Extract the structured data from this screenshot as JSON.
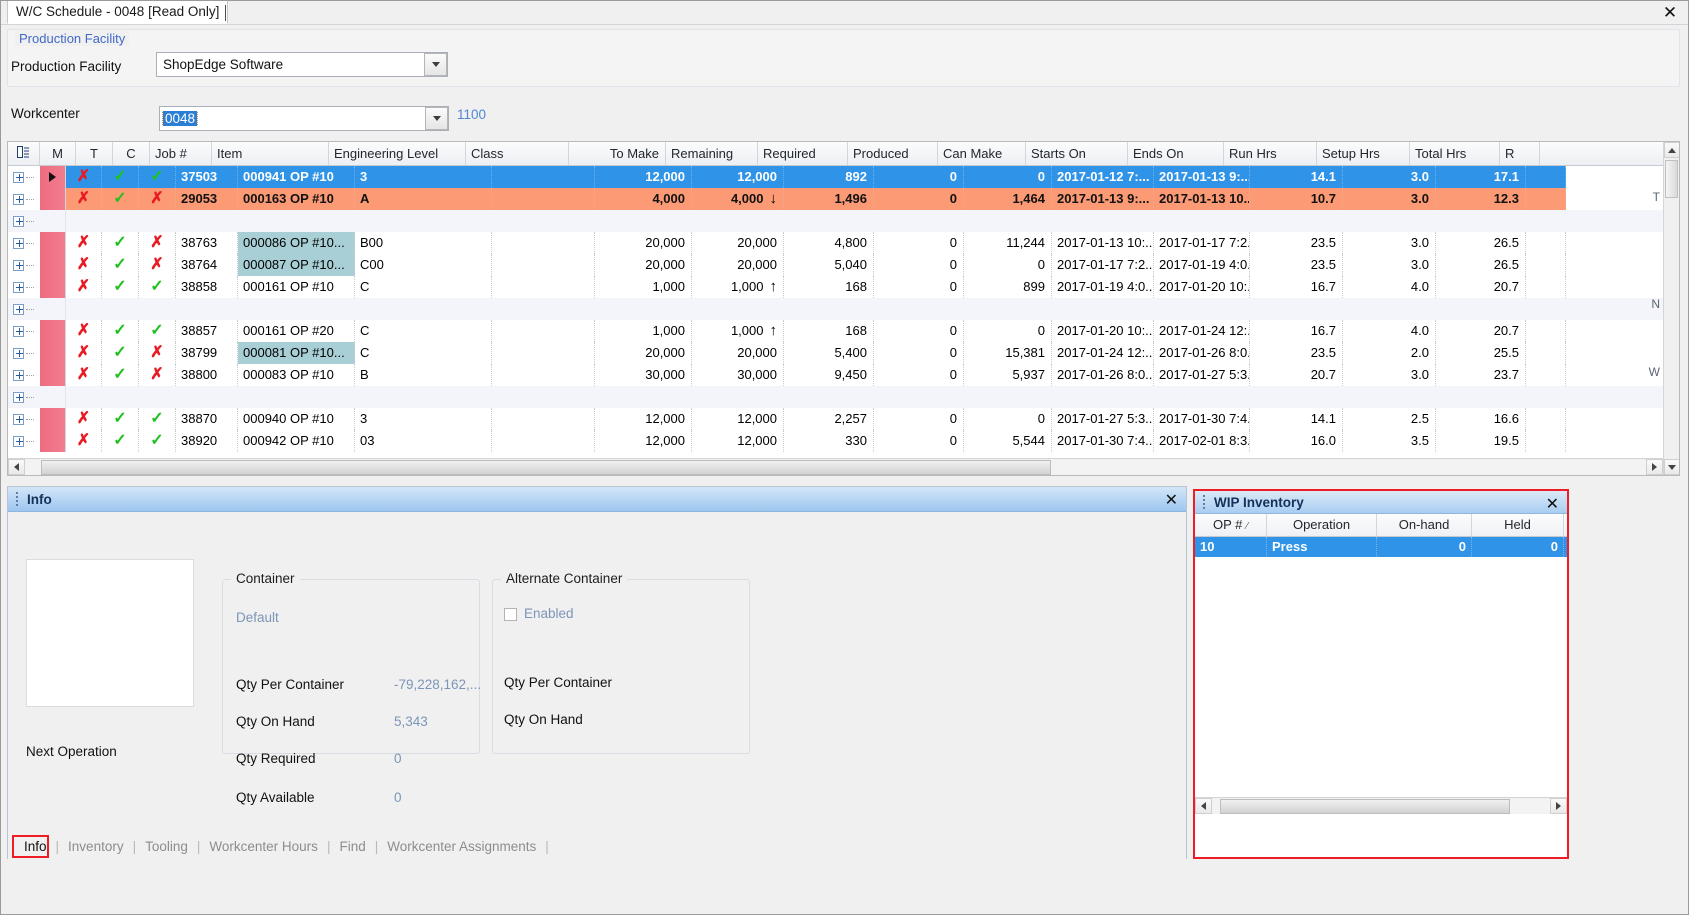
{
  "window": {
    "tab_title": "W/C Schedule - 0048 [Read Only]",
    "close_label": "✕"
  },
  "production_facility_group": {
    "legend": "Production Facility",
    "label": "Production Facility",
    "value": "ShopEdge Software"
  },
  "workcenter": {
    "label": "Workcenter",
    "value": "0048",
    "extra": "1100"
  },
  "grid": {
    "columns": [
      "M",
      "T",
      "C",
      "Job #",
      "Item",
      "Engineering Level",
      "Class",
      "To Make",
      "Remaining",
      "Required",
      "Produced",
      "Can Make",
      "Starts On",
      "Ends On",
      "Run Hrs",
      "Setup Hrs",
      "Total Hrs",
      "R"
    ],
    "rows": [
      {
        "type": "selected",
        "marker": "play",
        "m": "✗",
        "t": "✓",
        "c": "✓",
        "job": "37503",
        "item": "000941 OP #10",
        "eng": "3",
        "class": "",
        "to_make": "12,000",
        "remaining": "12,000",
        "remaining_arrow": "",
        "required": "892",
        "produced": "0",
        "can_make": "0",
        "starts_on": "2017-01-12 7:...",
        "ends_on": "2017-01-13 9:...",
        "run_hrs": "14.1",
        "setup_hrs": "3.0",
        "total_hrs": "17.1"
      },
      {
        "type": "warn",
        "marker": "pink",
        "m": "✗",
        "t": "✓",
        "c": "✗",
        "job": "29053",
        "item": "000163 OP #10",
        "eng": "A",
        "class": "",
        "to_make": "4,000",
        "remaining": "4,000",
        "remaining_arrow": "↓",
        "required": "1,496",
        "produced": "0",
        "can_make": "1,464",
        "starts_on": "2017-01-13 9:...",
        "ends_on": "2017-01-13 10...",
        "run_hrs": "10.7",
        "setup_hrs": "3.0",
        "total_hrs": "12.3"
      },
      {
        "type": "spacer",
        "marker": "blank"
      },
      {
        "type": "normal",
        "marker": "pink",
        "m": "✗",
        "t": "✓",
        "c": "✗",
        "job": "38763",
        "item": "000086 OP #10...",
        "item_highlight": true,
        "eng": "B00",
        "class": "",
        "to_make": "20,000",
        "remaining": "20,000",
        "remaining_arrow": "",
        "required": "4,800",
        "produced": "0",
        "can_make": "11,244",
        "starts_on": "2017-01-13 10:...",
        "ends_on": "2017-01-17 7:2...",
        "run_hrs": "23.5",
        "setup_hrs": "3.0",
        "total_hrs": "26.5"
      },
      {
        "type": "normal",
        "marker": "pink",
        "m": "✗",
        "t": "✓",
        "c": "✗",
        "job": "38764",
        "item": "000087 OP #10...",
        "item_highlight": true,
        "eng": "C00",
        "class": "",
        "to_make": "20,000",
        "remaining": "20,000",
        "remaining_arrow": "",
        "required": "5,040",
        "produced": "0",
        "can_make": "0",
        "starts_on": "2017-01-17 7:2...",
        "ends_on": "2017-01-19 4:0...",
        "run_hrs": "23.5",
        "setup_hrs": "3.0",
        "total_hrs": "26.5"
      },
      {
        "type": "normal",
        "marker": "pink",
        "m": "✗",
        "t": "✓",
        "c": "✓",
        "job": "38858",
        "item": "000161 OP #10",
        "eng": "C",
        "class": "",
        "to_make": "1,000",
        "remaining": "1,000",
        "remaining_arrow": "↑",
        "required": "168",
        "produced": "0",
        "can_make": "899",
        "starts_on": "2017-01-19 4:0...",
        "ends_on": "2017-01-20 10:...",
        "run_hrs": "16.7",
        "setup_hrs": "4.0",
        "total_hrs": "20.7"
      },
      {
        "type": "spacer",
        "marker": "blank"
      },
      {
        "type": "normal",
        "marker": "pink",
        "m": "✗",
        "t": "✓",
        "c": "✓",
        "job": "38857",
        "item": "000161 OP #20",
        "eng": "C",
        "class": "",
        "to_make": "1,000",
        "remaining": "1,000",
        "remaining_arrow": "↑",
        "required": "168",
        "produced": "0",
        "can_make": "0",
        "starts_on": "2017-01-20 10:...",
        "ends_on": "2017-01-24 12:...",
        "run_hrs": "16.7",
        "setup_hrs": "4.0",
        "total_hrs": "20.7"
      },
      {
        "type": "normal",
        "marker": "pink",
        "m": "✗",
        "t": "✓",
        "c": "✗",
        "job": "38799",
        "item": "000081 OP #10...",
        "item_highlight": true,
        "eng": "C",
        "class": "",
        "to_make": "20,000",
        "remaining": "20,000",
        "remaining_arrow": "",
        "required": "5,400",
        "produced": "0",
        "can_make": "15,381",
        "starts_on": "2017-01-24 12:...",
        "ends_on": "2017-01-26 8:0...",
        "run_hrs": "23.5",
        "setup_hrs": "2.0",
        "total_hrs": "25.5"
      },
      {
        "type": "normal",
        "marker": "pink",
        "m": "✗",
        "t": "✓",
        "c": "✗",
        "job": "38800",
        "item": "000083 OP #10",
        "eng": "B",
        "class": "",
        "to_make": "30,000",
        "remaining": "30,000",
        "remaining_arrow": "",
        "required": "9,450",
        "produced": "0",
        "can_make": "5,937",
        "starts_on": "2017-01-26 8:0...",
        "ends_on": "2017-01-27 5:3...",
        "run_hrs": "20.7",
        "setup_hrs": "3.0",
        "total_hrs": "23.7"
      },
      {
        "type": "spacer",
        "marker": "blank"
      },
      {
        "type": "normal",
        "marker": "pink",
        "m": "✗",
        "t": "✓",
        "c": "✓",
        "job": "38870",
        "item": "000940 OP #10",
        "eng": "3",
        "class": "",
        "to_make": "12,000",
        "remaining": "12,000",
        "remaining_arrow": "",
        "required": "2,257",
        "produced": "0",
        "can_make": "0",
        "starts_on": "2017-01-27 5:3...",
        "ends_on": "2017-01-30 7:4...",
        "run_hrs": "14.1",
        "setup_hrs": "2.5",
        "total_hrs": "16.6"
      },
      {
        "type": "normal",
        "marker": "pink",
        "m": "✗",
        "t": "✓",
        "c": "✓",
        "job": "38920",
        "item": "000942 OP #10",
        "eng": "03",
        "class": "",
        "to_make": "12,000",
        "remaining": "12,000",
        "remaining_arrow": "",
        "required": "330",
        "produced": "0",
        "can_make": "5,544",
        "starts_on": "2017-01-30 7:4...",
        "ends_on": "2017-02-01 8:3...",
        "run_hrs": "16.0",
        "setup_hrs": "3.5",
        "total_hrs": "19.5"
      }
    ],
    "side_marks": [
      "T",
      "N",
      "W"
    ]
  },
  "info_panel": {
    "title": "Info",
    "close_label": "✕",
    "next_operation_label": "Next Operation",
    "container": {
      "legend": "Container",
      "default_label": "Default",
      "rows": [
        {
          "label": "Qty Per Container",
          "value": "-79,228,162,..."
        },
        {
          "label": "Qty On Hand",
          "value": "5,343"
        },
        {
          "label": "Qty Required",
          "value": "0"
        },
        {
          "label": "Qty Available",
          "value": "0"
        }
      ]
    },
    "alternate_container": {
      "legend": "Alternate Container",
      "enabled_label": "Enabled",
      "enabled_checked": false,
      "rows": [
        {
          "label": "Qty Per Container",
          "value": ""
        },
        {
          "label": "Qty On Hand",
          "value": ""
        }
      ]
    }
  },
  "bottom_tabs": {
    "items": [
      {
        "label": "Info",
        "active": true
      },
      {
        "label": "Inventory",
        "active": false
      },
      {
        "label": "Tooling",
        "active": false
      },
      {
        "label": "Workcenter Hours",
        "active": false
      },
      {
        "label": "Find",
        "active": false
      },
      {
        "label": "Workcenter Assignments",
        "active": false
      }
    ],
    "separator": "|"
  },
  "wip_inventory": {
    "title": "WIP Inventory",
    "close_label": "✕",
    "columns": [
      "OP #",
      "Operation",
      "On-hand",
      "Held"
    ],
    "sort_indicator": "⁄",
    "rows": [
      {
        "op": "10",
        "operation": "Press",
        "on_hand": "0",
        "held": "0",
        "selected": true
      }
    ]
  }
}
